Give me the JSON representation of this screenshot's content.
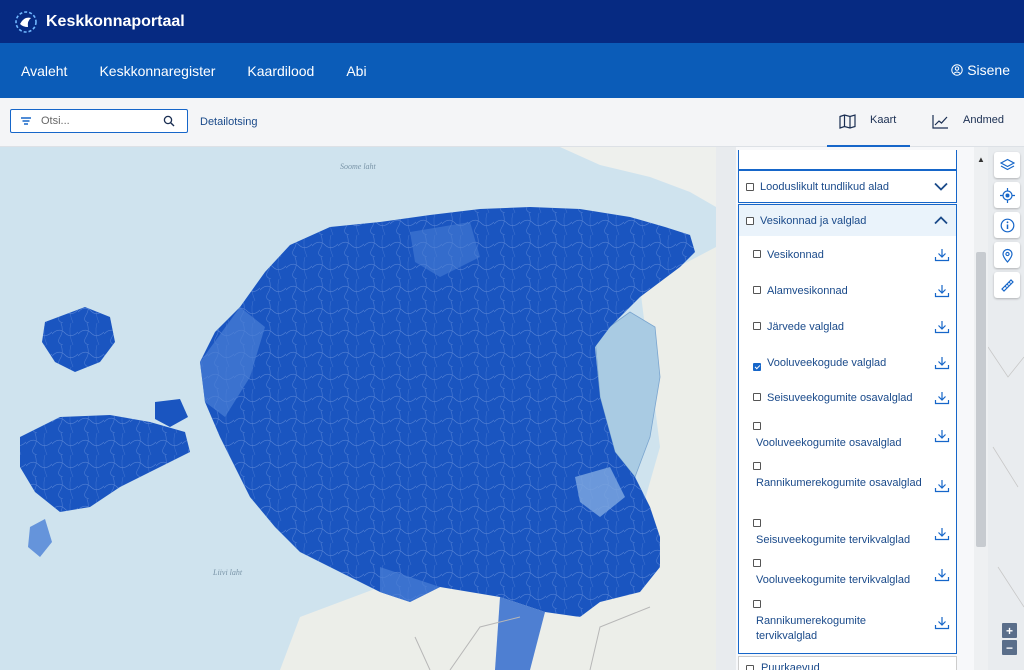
{
  "header": {
    "brand": "Keskkonnaportaal"
  },
  "nav": {
    "items": [
      "Avaleht",
      "Keskkonnaregister",
      "Kaardilood",
      "Abi"
    ],
    "login": "Sisene"
  },
  "toolbar": {
    "search_placeholder": "Otsi...",
    "detail_search": "Detailotsing",
    "tab_map": "Kaart",
    "tab_data": "Andmed",
    "active_tab": "Kaart"
  },
  "map": {
    "sea_labels": [
      "Soome laht",
      "Liivi laht"
    ]
  },
  "layers_panel": {
    "groups": [
      {
        "label": "Looduslikult tundlikud alad",
        "expanded": false
      },
      {
        "label": "Vesikonnad ja valglad",
        "expanded": true
      }
    ],
    "layers": [
      {
        "label": "Vesikonnad",
        "checked": false
      },
      {
        "label": "Alamvesikonnad",
        "checked": false
      },
      {
        "label": "Järvede valglad",
        "checked": false
      },
      {
        "label": "Vooluveekogude valglad",
        "checked": true
      },
      {
        "label": "Seisuveekogumite osavalglad",
        "checked": false
      },
      {
        "label": "Vooluveekogumite osavalglad",
        "checked": false
      },
      {
        "label": "Rannikumerekogumite osavalglad",
        "checked": false
      },
      {
        "label": "Seisuveekogumite tervikvalglad",
        "checked": false
      },
      {
        "label": "Vooluveekogumite tervikvalglad",
        "checked": false
      },
      {
        "label": "Rannikumerekogumite tervikvalglad",
        "checked": false
      }
    ],
    "next_group": "Puurkaevud"
  },
  "colors": {
    "topbar": "#062a82",
    "navbar": "#0b5cb8",
    "accent": "#1666c9",
    "map_fill": "#1a55c0",
    "sea": "#cfe3ee"
  },
  "icons": {
    "tools": [
      "layers-icon",
      "locate-icon",
      "info-icon",
      "marker-icon",
      "measure-icon"
    ]
  }
}
